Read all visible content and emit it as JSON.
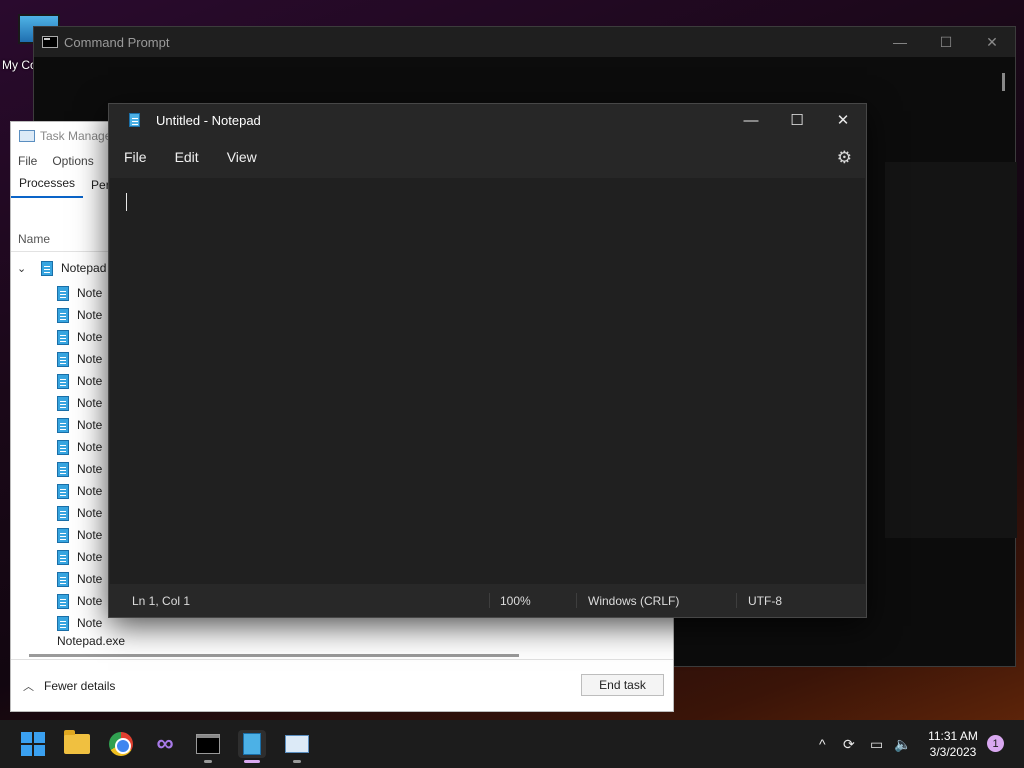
{
  "desktop": {
    "icon_label": "My Co"
  },
  "command_prompt": {
    "title": "Command Prompt",
    "controls": {
      "minimize": "—",
      "maximize": "☐",
      "close": "✕"
    }
  },
  "task_manager": {
    "title": "Task Manage",
    "menu": [
      "File",
      "Options"
    ],
    "tabs": [
      "Processes",
      "Perfo"
    ],
    "column_header": "Name",
    "group_label": "Notepad",
    "rows": [
      "Note",
      "Note",
      "Note",
      "Note",
      "Note",
      "Note",
      "Note",
      "Note",
      "Note",
      "Note",
      "Note",
      "Note",
      "Note",
      "Note",
      "Note",
      "Note",
      "Notepad.exe"
    ],
    "fewer_details": "Fewer details",
    "end_task": "End task"
  },
  "notepad": {
    "title": "Untitled - Notepad",
    "menu": {
      "file": "File",
      "edit": "Edit",
      "view": "View"
    },
    "controls": {
      "minimize": "—",
      "maximize": "☐",
      "close": "✕"
    },
    "status": {
      "position": "Ln 1, Col 1",
      "zoom": "100%",
      "line_ending": "Windows (CRLF)",
      "encoding": "UTF-8"
    }
  },
  "taskbar": {
    "apps": [
      "start-icon",
      "file-explorer-icon",
      "chrome-icon",
      "visual-studio-icon",
      "command-prompt-icon",
      "notepad-icon",
      "task-manager-icon"
    ],
    "clock": {
      "time": "11:31 AM",
      "date": "3/3/2023"
    },
    "notification_count": "1"
  }
}
